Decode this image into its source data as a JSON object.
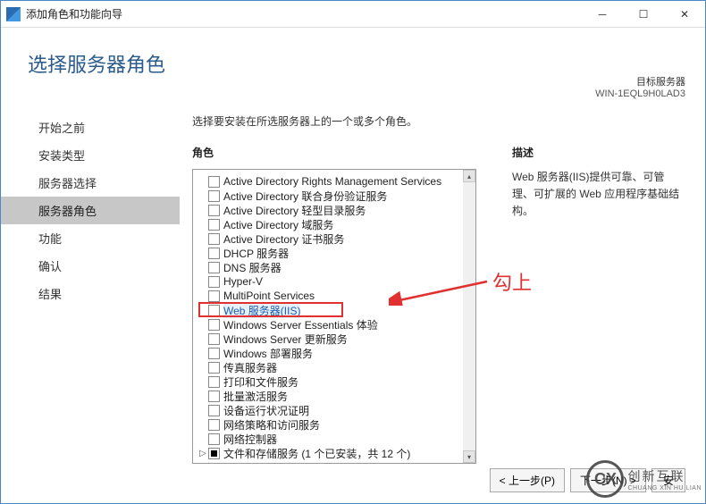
{
  "window": {
    "title": "添加角色和功能向导"
  },
  "page": {
    "title": "选择服务器角色"
  },
  "target": {
    "label": "目标服务器",
    "name": "WIN-1EQL9H0LAD3"
  },
  "sidebar": {
    "items": [
      {
        "label": "开始之前"
      },
      {
        "label": "安装类型"
      },
      {
        "label": "服务器选择"
      },
      {
        "label": "服务器角色"
      },
      {
        "label": "功能"
      },
      {
        "label": "确认"
      },
      {
        "label": "结果"
      }
    ],
    "activeIndex": 3
  },
  "instruction": "选择要安装在所选服务器上的一个或多个角色。",
  "columns": {
    "roles": "角色",
    "description": "描述"
  },
  "roles": [
    {
      "label": "Active Directory Rights Management Services"
    },
    {
      "label": "Active Directory 联合身份验证服务"
    },
    {
      "label": "Active Directory 轻型目录服务"
    },
    {
      "label": "Active Directory 域服务"
    },
    {
      "label": "Active Directory 证书服务"
    },
    {
      "label": "DHCP 服务器"
    },
    {
      "label": "DNS 服务器"
    },
    {
      "label": "Hyper-V"
    },
    {
      "label": "MultiPoint Services"
    },
    {
      "label": "Web 服务器(IIS)",
      "highlighted": true
    },
    {
      "label": "Windows Server Essentials 体验"
    },
    {
      "label": "Windows Server 更新服务"
    },
    {
      "label": "Windows 部署服务"
    },
    {
      "label": "传真服务器"
    },
    {
      "label": "打印和文件服务"
    },
    {
      "label": "批量激活服务"
    },
    {
      "label": "设备运行状况证明"
    },
    {
      "label": "网络策略和访问服务"
    },
    {
      "label": "网络控制器"
    },
    {
      "label": "文件和存储服务 (1 个已安装，共 12 个)",
      "expandable": true,
      "filled": true
    }
  ],
  "description": "Web 服务器(IIS)提供可靠、可管理、可扩展的 Web 应用程序基础结构。",
  "annotation": "勾上",
  "buttons": {
    "prev": "< 上一步(P)",
    "next": "下一步(N) >",
    "install": "安"
  },
  "watermark": {
    "glyph": "CX",
    "text": "创新互联",
    "sub": "CHUANG XIN HU LIAN"
  }
}
